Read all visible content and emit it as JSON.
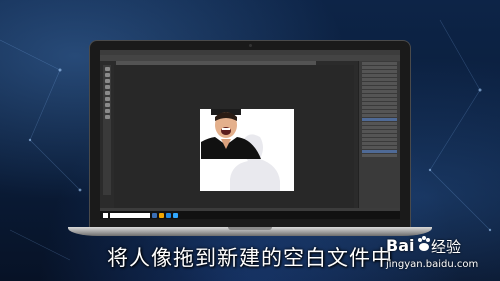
{
  "caption": "将人像拖到新建的空白文件中",
  "watermark": {
    "brand": "Bai",
    "brand_sub": "经验",
    "url": "jingyan.baidu.com"
  },
  "colors": {
    "background": "#0b1f3d",
    "ps_dark": "#2b2b2b",
    "panel_highlight": "#4f6a96",
    "document": "#ffffff"
  },
  "icons": [
    "paw-icon",
    "windows-start-icon",
    "camera-dot"
  ]
}
